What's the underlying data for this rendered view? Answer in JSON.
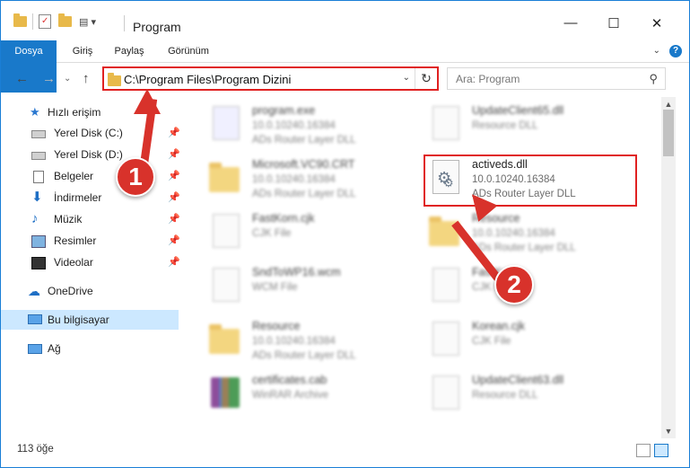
{
  "window": {
    "title": "Program",
    "controls": {
      "minimize": "—",
      "maximize": "☐",
      "close": "✕"
    }
  },
  "ribbon": {
    "tabs": [
      "Dosya",
      "Giriş",
      "Paylaş",
      "Görünüm"
    ],
    "help_label": "?"
  },
  "nav": {
    "address_path": "C:\\Program Files\\Program Dizini",
    "search_placeholder": "Ara: Program"
  },
  "sidebar": {
    "items": [
      {
        "label": "Hızlı erişim",
        "icon": "star-icon",
        "pinned": false
      },
      {
        "label": "Yerel Disk (C:)",
        "icon": "drive-icon",
        "pinned": true
      },
      {
        "label": "Yerel Disk (D:)",
        "icon": "drive-icon",
        "pinned": true
      },
      {
        "label": "Belgeler",
        "icon": "documents-icon",
        "pinned": true
      },
      {
        "label": "İndirmeler",
        "icon": "download-icon",
        "pinned": true
      },
      {
        "label": "Müzik",
        "icon": "music-icon",
        "pinned": true
      },
      {
        "label": "Resimler",
        "icon": "pictures-icon",
        "pinned": true
      },
      {
        "label": "Videolar",
        "icon": "videos-icon",
        "pinned": true
      },
      {
        "label": "OneDrive",
        "icon": "cloud-icon",
        "pinned": false
      },
      {
        "label": "Bu bilgisayar",
        "icon": "computer-icon",
        "pinned": false
      },
      {
        "label": "Ağ",
        "icon": "network-icon",
        "pinned": false
      }
    ],
    "selected": "Bu bilgisayar"
  },
  "files": [
    {
      "name": "program.exe",
      "line2": "10.0.10240.16384",
      "line3": "ADs Router Layer DLL",
      "icon": "exe-icon"
    },
    {
      "name": "UpdateClient65.dll",
      "line2": "Resource DLL",
      "line3": "",
      "icon": "dll-icon"
    },
    {
      "name": "Microsoft.VC90.CRT",
      "line2": "10.0.10240.16384",
      "line3": "ADs Router Layer DLL",
      "icon": "folder-icon"
    },
    {
      "name": "activeds.dll",
      "line2": "10.0.10240.16384",
      "line3": "ADs Router Layer DLL",
      "icon": "dll-gear-icon"
    },
    {
      "name": "FastKorn.cjk",
      "line2": "CJK File",
      "line3": "",
      "icon": "file-icon"
    },
    {
      "name": "Resource",
      "line2": "10.0.10240.16384",
      "line3": "ADs Router Layer DLL",
      "icon": "folder-icon"
    },
    {
      "name": "SndToWP16.wcm",
      "line2": "WCM File",
      "line3": "",
      "icon": "file-icon"
    },
    {
      "name": "FastKorn",
      "line2": "CJK File",
      "line3": "",
      "icon": "file-icon"
    },
    {
      "name": "Resource",
      "line2": "10.0.10240.16384",
      "line3": "ADs Router Layer DLL",
      "icon": "folder-icon"
    },
    {
      "name": "Korean.cjk",
      "line2": "CJK File",
      "line3": "",
      "icon": "file-icon"
    },
    {
      "name": "certificates.cab",
      "line2": "WinRAR Archive",
      "line3": "",
      "icon": "archive-icon"
    },
    {
      "name": "UpdateClient63.dll",
      "line2": "Resource DLL",
      "line3": "",
      "icon": "dll-icon"
    }
  ],
  "status": {
    "item_count": "113 öğe"
  },
  "callouts": [
    "1",
    "2"
  ],
  "colors": {
    "accent": "#1979ca",
    "highlight": "#e02121",
    "callout": "#d8322b",
    "selection": "#cce8ff"
  }
}
